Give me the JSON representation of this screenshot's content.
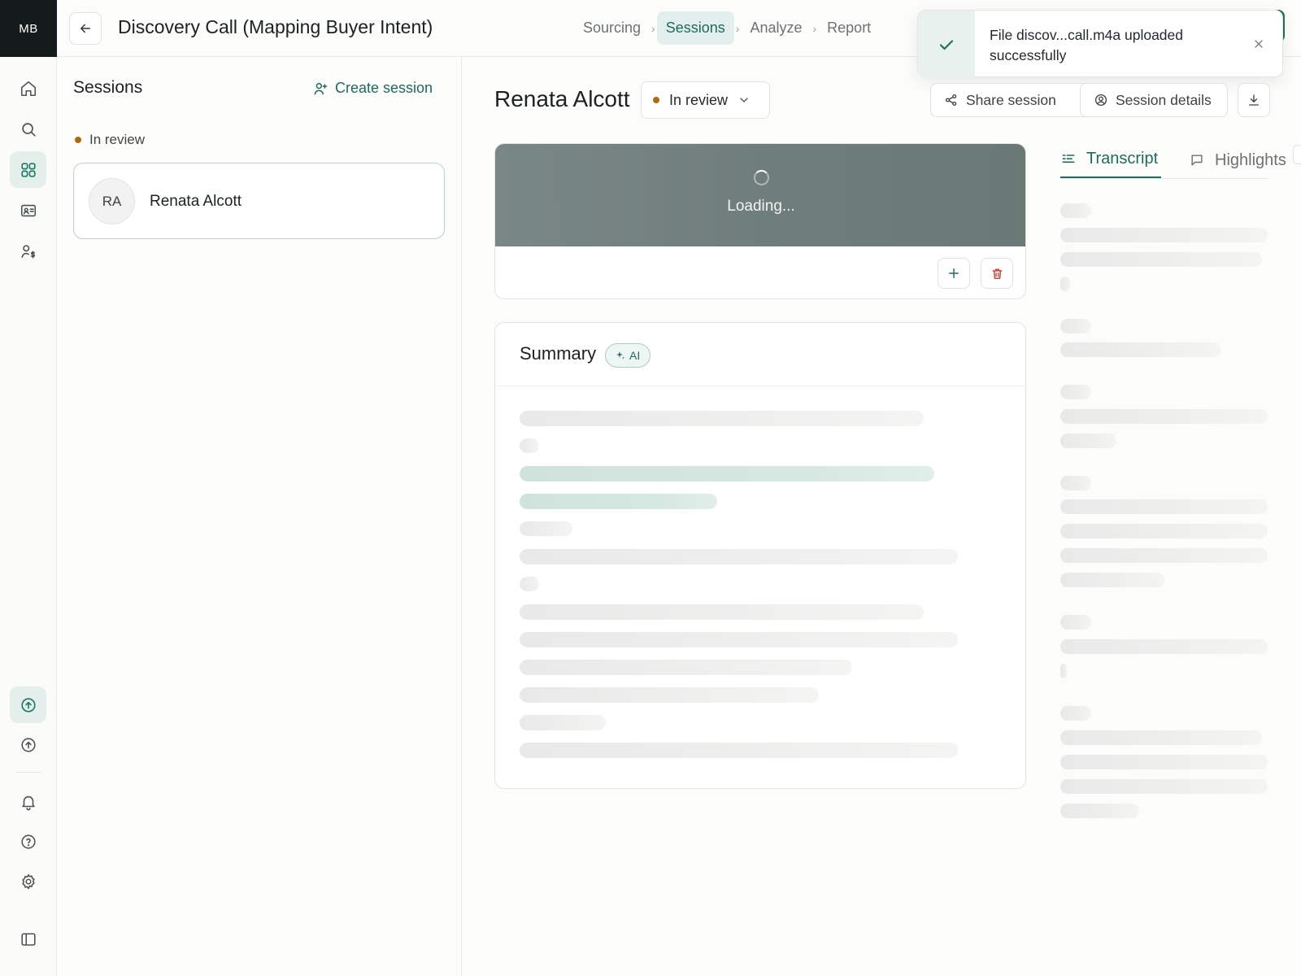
{
  "app": {
    "logo": "MB"
  },
  "header": {
    "title": "Discovery Call (Mapping Buyer Intent)",
    "steps": [
      "Sourcing",
      "Sessions",
      "Analyze",
      "Report"
    ],
    "active_step": "Sessions"
  },
  "toast": {
    "message": "File discov...call.m4a uploaded successfully"
  },
  "sessions_panel": {
    "title": "Sessions",
    "create_label": "Create session",
    "group_label": "In review",
    "items": [
      {
        "initials": "RA",
        "name": "Renata Alcott"
      }
    ]
  },
  "session": {
    "name": "Renata Alcott",
    "status": "In review",
    "share_label": "Share session",
    "details_label": "Session details"
  },
  "media": {
    "loading_text": "Loading..."
  },
  "summary": {
    "title": "Summary",
    "badge": "AI"
  },
  "tabs": {
    "transcript": "Transcript",
    "highlights": "Highlights"
  },
  "colors": {
    "accent": "#1f6f5e",
    "status_dot": "#b06a12",
    "danger": "#c0392b"
  }
}
